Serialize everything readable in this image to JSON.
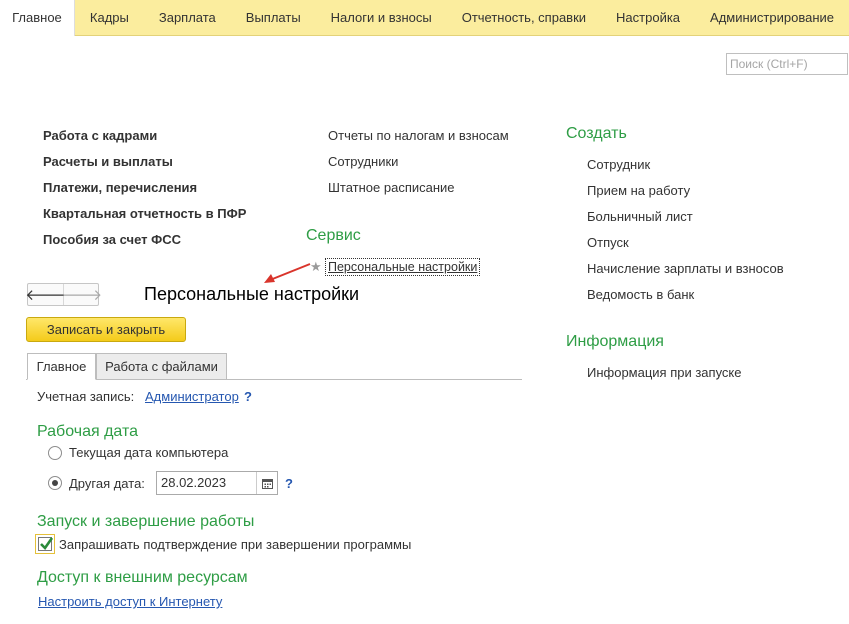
{
  "menu": {
    "tabs": [
      {
        "label": "Главное"
      },
      {
        "label": "Кадры"
      },
      {
        "label": "Зарплата"
      },
      {
        "label": "Выплаты"
      },
      {
        "label": "Налоги и взносы"
      },
      {
        "label": "Отчетность, справки"
      },
      {
        "label": "Настройка"
      },
      {
        "label": "Администрирование"
      }
    ]
  },
  "search": {
    "placeholder": "Поиск (Ctrl+F)"
  },
  "sections": [
    "Работа с кадрами",
    "Расчеты и выплаты",
    "Платежи, перечисления",
    "Квартальная отчетность в ПФР",
    "Пособия за счет ФСС"
  ],
  "middle_links": [
    "Отчеты по налогам и взносам",
    "Сотрудники",
    "Штатное расписание"
  ],
  "service": {
    "heading": "Сервис",
    "item": "Персональные настройки"
  },
  "create": {
    "heading": "Создать",
    "items": [
      "Сотрудник",
      "Прием на работу",
      "Больничный лист",
      "Отпуск",
      "Начисление зарплаты и взносов",
      "Ведомость в банк"
    ]
  },
  "info": {
    "heading": "Информация",
    "items": [
      "Информация при запуске"
    ]
  },
  "form": {
    "title": "Персональные настройки",
    "save_close": "Записать и закрыть",
    "tabs": [
      "Главное",
      "Работа с файлами"
    ],
    "account_label": "Учетная запись:",
    "account_value": "Администратор",
    "help": "?",
    "work_date": {
      "heading": "Рабочая дата",
      "option_current": "Текущая дата компьютера",
      "option_other": "Другая дата:",
      "date_value": "28.02.2023",
      "selected": "other"
    },
    "startup": {
      "heading": "Запуск и завершение работы",
      "confirm_exit": "Запрашивать подтверждение при завершении программы",
      "confirm_exit_checked": true
    },
    "external": {
      "heading": "Доступ к внешним ресурсам",
      "internet_link": "Настроить доступ к Интернету"
    }
  },
  "colors": {
    "menu_bg": "#fbed9e",
    "accent_green": "#2e9d45",
    "link_blue": "#2557b0",
    "button_yellow": "#f4cb1a",
    "arrow_red": "#d9342b"
  }
}
